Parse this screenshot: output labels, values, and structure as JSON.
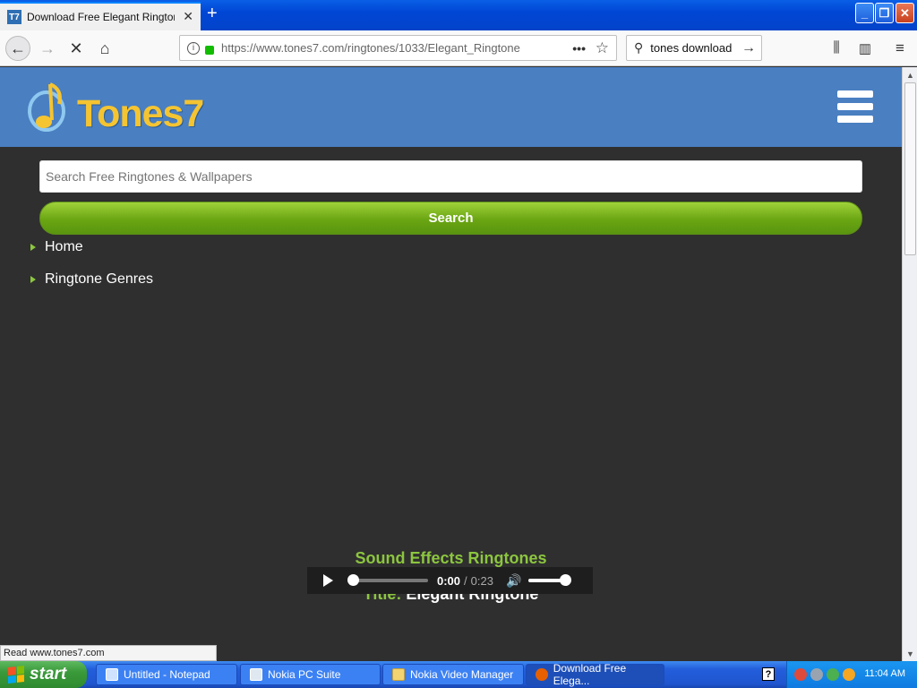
{
  "browser": {
    "tab_title": "Download Free Elegant Ringtone F",
    "tab_favicon": "T7",
    "new_tab": "+",
    "url": "https://www.tones7.com/ringtones/1033/Elegant_Ringtone",
    "search_value": "tones download",
    "status_text": "Read www.tones7.com",
    "icons": [
      "back-icon",
      "forward-icon",
      "stop-icon",
      "home-icon",
      "info-icon",
      "lock-icon",
      "more-icon",
      "star-icon",
      "search-icon",
      "arrow-right-icon",
      "library-icon",
      "sidebar-icon",
      "hamburger-icon"
    ]
  },
  "site": {
    "logo_text": "Tones7",
    "search_placeholder": "Search Free Ringtones & Wallpapers",
    "search_button": "Search",
    "nav": [
      "Home",
      "Ringtone Genres"
    ],
    "category": "Sound Effects Ringtones",
    "title_label": "Title:",
    "title_value": "Elegant Ringtone"
  },
  "player": {
    "time_current": "0:00",
    "time_separator": "/",
    "time_total": "0:23",
    "progress": 0,
    "volume": 1.0
  },
  "taskbar": {
    "start": "start",
    "tasks": [
      "Untitled - Notepad",
      "Nokia PC Suite",
      "Nokia Video Manager",
      "Download Free Elega..."
    ],
    "help": "?",
    "clock": "11:04 AM"
  },
  "colors": {
    "header_blue": "#4a7fc1",
    "accent_green": "#8cc63f",
    "logo_yellow": "#f5c431",
    "page_bg": "#2f2f2f"
  }
}
